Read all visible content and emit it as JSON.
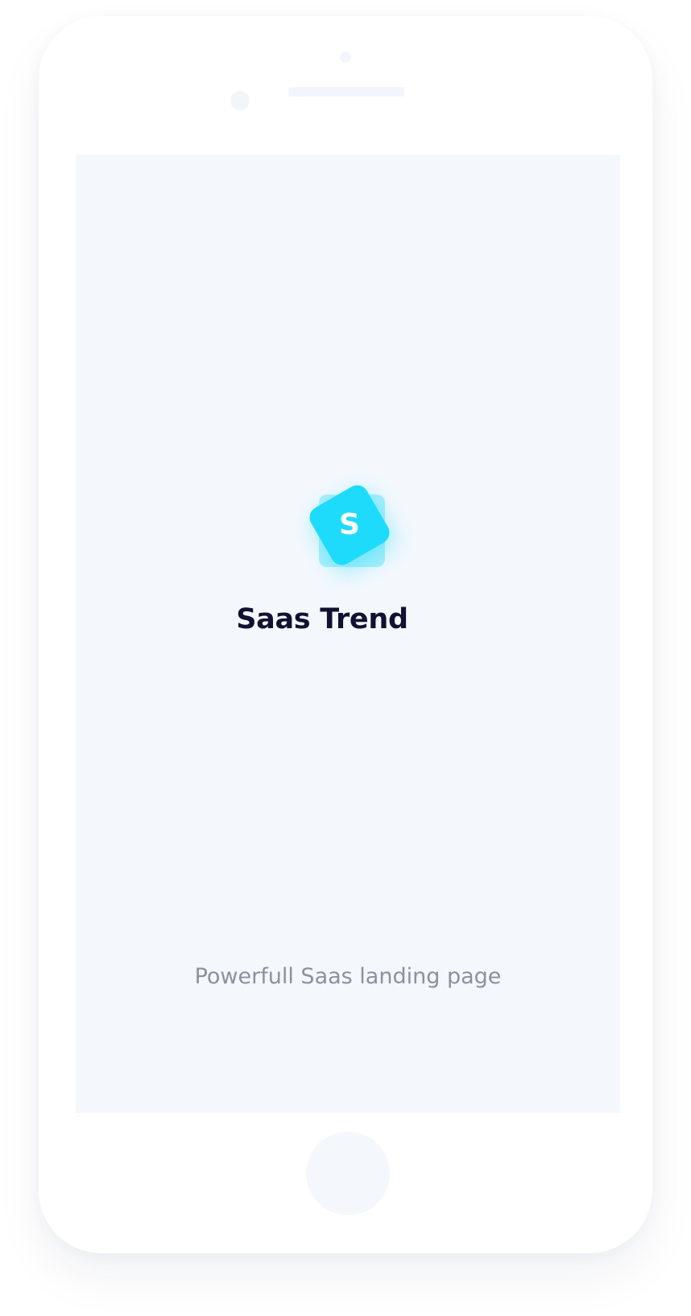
{
  "app": {
    "logo_letter": "S",
    "brand_name": "Saas Trend",
    "tagline": "Powerfull Saas landing page"
  },
  "colors": {
    "accent": "#1edbfb",
    "title_text": "#131132",
    "subtitle_text": "#8e8f9f",
    "screen_background": "#f4f8fd",
    "device_body": "#ffffff"
  },
  "icons": {
    "logo": "rotated-square-logo-icon",
    "camera": "front-camera-icon",
    "sensor": "proximity-sensor-icon",
    "speaker": "earpiece-speaker-icon",
    "home": "home-button-icon"
  }
}
